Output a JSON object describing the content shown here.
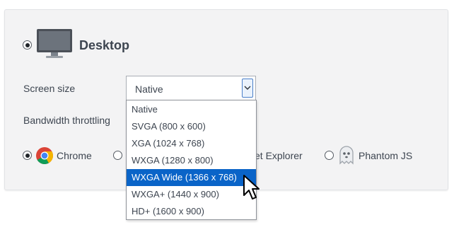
{
  "desktop": {
    "title": "Desktop",
    "icon": "monitor-icon",
    "selected": true
  },
  "screen_size": {
    "label": "Screen size",
    "value": "Native",
    "options": [
      "Native",
      "SVGA (800 x 600)",
      "XGA (1024 x 768)",
      "WXGA (1280 x 800)",
      "WXGA Wide (1366 x 768)",
      "WXGA+ (1440 x 900)",
      "HD+ (1600 x 900)"
    ],
    "highlighted_option": "WXGA Wide (1366 x 768)"
  },
  "bandwidth": {
    "label": "Bandwidth throttling"
  },
  "browsers": {
    "chrome": {
      "label": "Chrome",
      "icon": "chrome-icon",
      "selected": true
    },
    "ie": {
      "label": "et Explorer"
    },
    "phantom": {
      "label": "Phantom JS",
      "icon": "ghost-icon",
      "selected": false
    }
  },
  "colors": {
    "highlight": "#0a64c8",
    "panel_bg": "#f3f3f4",
    "text": "#3d4550"
  }
}
